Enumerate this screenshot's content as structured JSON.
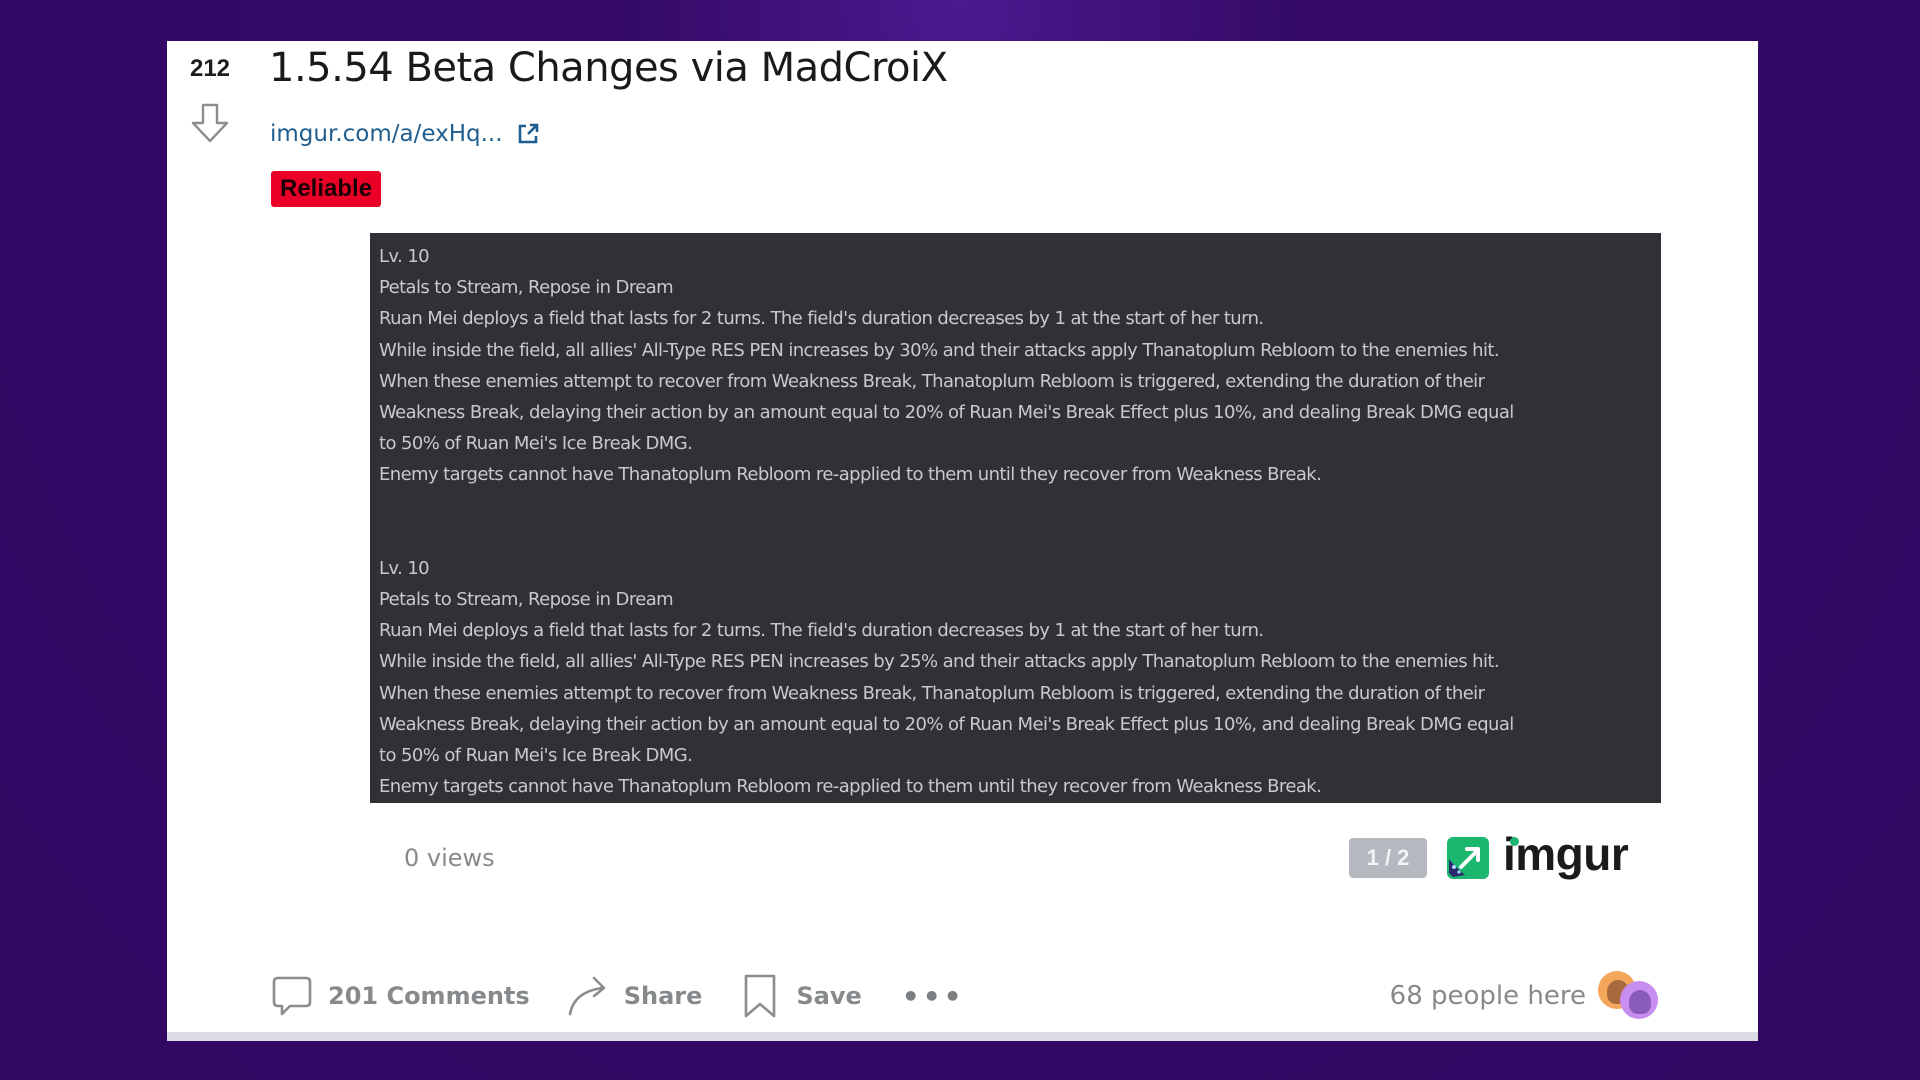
{
  "post": {
    "score": "212",
    "title": "1.5.54 Beta Changes via MadCroiX",
    "link_text": "imgur.com/a/exHq...",
    "flair": "Reliable",
    "flair_color": "#ea0027"
  },
  "embed": {
    "block1": [
      "Lv. 10",
      "Petals to Stream, Repose in Dream",
      "Ruan Mei deploys a field that lasts for 2 turns. The field's duration decreases by 1 at the start of her turn.",
      "While inside the field, all allies' All-Type RES PEN increases by 30% and their attacks apply Thanatoplum Rebloom to the enemies hit.",
      "When these enemies attempt to recover from Weakness Break, Thanatoplum Rebloom is triggered, extending the duration of their",
      "Weakness Break, delaying their action by an amount equal to 20% of Ruan Mei's Break Effect plus 10%, and dealing Break DMG equal",
      "to 50% of Ruan Mei's Ice Break DMG.",
      "Enemy targets cannot have Thanatoplum Rebloom re-applied to them until they recover from Weakness Break."
    ],
    "block2": [
      "Lv. 10",
      "Petals to Stream, Repose in Dream",
      "Ruan Mei deploys a field that lasts for 2 turns. The field's duration decreases by 1 at the start of her turn.",
      "While inside the field, all allies' All-Type RES PEN increases by 25% and their attacks apply Thanatoplum Rebloom to the enemies hit.",
      "When these enemies attempt to recover from Weakness Break, Thanatoplum Rebloom is triggered, extending the duration of their",
      "Weakness Break, delaying their action by an amount equal to 20% of Ruan Mei's Break Effect plus 10%, and dealing Break DMG equal",
      "to 50% of Ruan Mei's Ice Break DMG.",
      "Enemy targets cannot have Thanatoplum Rebloom re-applied to them until they recover from Weakness Break."
    ],
    "views": "0 views",
    "pager": "1 / 2",
    "brand": "imgur"
  },
  "actions": {
    "comments": "201 Comments",
    "share": "Share",
    "save": "Save",
    "more": "•••"
  },
  "presence": {
    "text": "68 people here"
  }
}
